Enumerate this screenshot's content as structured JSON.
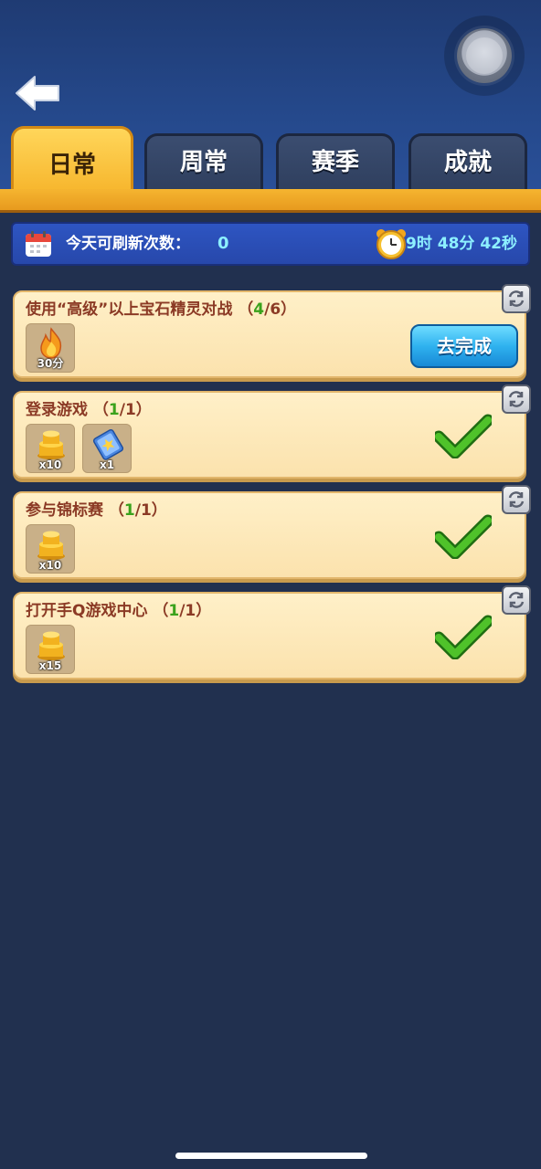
{
  "tabs": [
    {
      "label": "日常",
      "active": true
    },
    {
      "label": "周常",
      "active": false
    },
    {
      "label": "赛季",
      "active": false
    },
    {
      "label": "成就",
      "active": false
    }
  ],
  "refresh": {
    "label": "今天可刷新次数：",
    "count": "0",
    "countdown": "9时 48分 42秒"
  },
  "tasks": [
    {
      "title": "使用“高级”以上宝石精灵对战",
      "progress_open": "（",
      "progress_current": "4",
      "progress_rest": "/6）",
      "rewards": [
        {
          "icon": "fire-icon",
          "qty": "30分"
        }
      ],
      "action_label": "去完成"
    },
    {
      "title": "登录游戏",
      "progress_open": "（",
      "progress_current": "1",
      "progress_rest": "/1）",
      "rewards": [
        {
          "icon": "coin-stack-icon",
          "qty": "x10"
        },
        {
          "icon": "ticket-icon",
          "qty": "x1"
        }
      ],
      "completed": true
    },
    {
      "title": "参与锦标赛",
      "progress_open": "（",
      "progress_current": "1",
      "progress_rest": "/1）",
      "rewards": [
        {
          "icon": "coin-stack-icon",
          "qty": "x10"
        }
      ],
      "completed": true
    },
    {
      "title": "打开手Q游戏中心",
      "progress_open": "（",
      "progress_current": "1",
      "progress_rest": "/1）",
      "rewards": [
        {
          "icon": "coin-stack-icon",
          "qty": "x15"
        }
      ],
      "completed": true
    }
  ],
  "colors": {
    "accent_gold": "#f6b52c",
    "progress_green": "#3aa21c",
    "title_brown": "#8b3a25",
    "button_blue": "#2fb2ef"
  }
}
